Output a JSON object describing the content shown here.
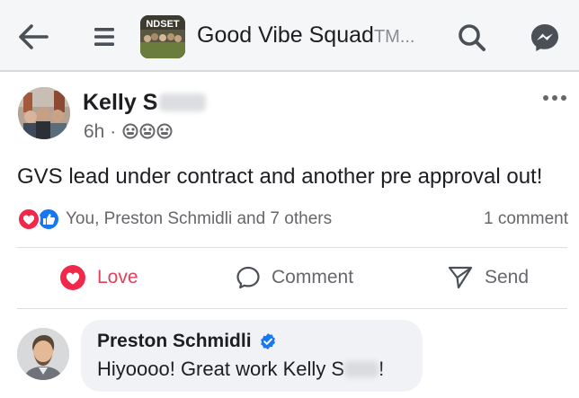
{
  "colors": {
    "topbar_bg": "#f5f6f7",
    "text_primary": "#1c1e21",
    "text_secondary": "#65676b",
    "love_red": "#e4405c",
    "like_blue": "#1877f2",
    "verified_blue": "#1877f2",
    "comment_bg": "#f0f2f5"
  },
  "topbar": {
    "back_icon": "arrow-left-icon",
    "menu_icon": "hamburger-menu-icon",
    "group_title": "Good Vibe Squad",
    "group_title_suffix": "TM...",
    "group_thumb_text": "NDSET",
    "search_icon": "search-icon",
    "messenger_icon": "messenger-icon"
  },
  "post": {
    "author_visible": "Kelly S",
    "time": "6h",
    "separator": "·",
    "privacy_icon": "group-members-icon",
    "more_icon": "more-dots-icon",
    "text": "GVS lead under contract and another pre approval out!"
  },
  "reactions": {
    "icons": [
      "love-reaction-icon",
      "like-reaction-icon"
    ],
    "names": "You, Preston Schmidli and 7 others",
    "comment_count": "1 comment"
  },
  "actions": {
    "love": "Love",
    "comment": "Comment",
    "send": "Send"
  },
  "comment": {
    "author": "Preston Schmidli",
    "verified_icon": "verified-badge-icon",
    "text_visible": "Hiyoooo! Great work Kelly S",
    "text_end": "!"
  }
}
